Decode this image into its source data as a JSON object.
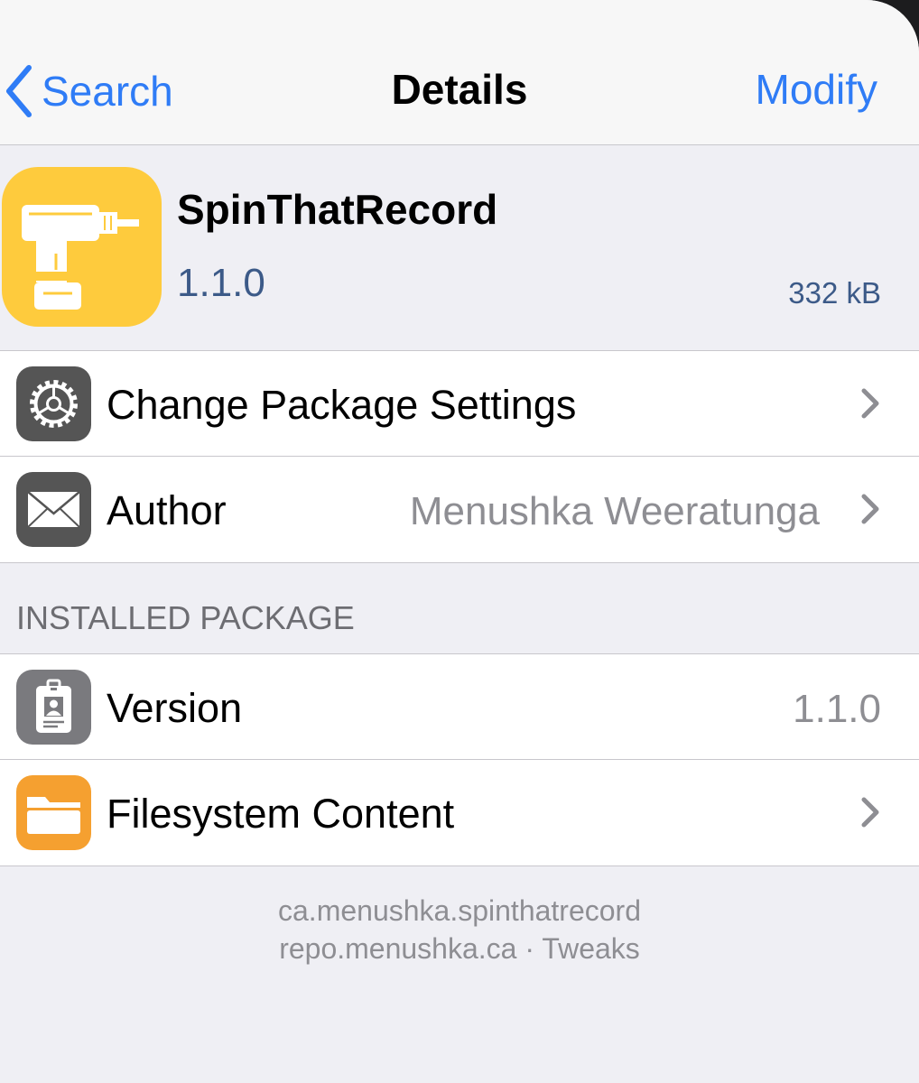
{
  "nav": {
    "back_label": "Search",
    "title": "Details",
    "action_label": "Modify"
  },
  "package": {
    "name": "SpinThatRecord",
    "version": "1.1.0",
    "size": "332 kB",
    "icon": "drill-icon"
  },
  "rows": [
    {
      "label": "Change Package Settings",
      "icon": "gear-icon"
    },
    {
      "label": "Author",
      "value": "Menushka Weeratunga",
      "icon": "mail-icon"
    }
  ],
  "installed_section": {
    "header": "INSTALLED PACKAGE",
    "rows": [
      {
        "label": "Version",
        "value": "1.1.0",
        "icon": "id-badge-icon"
      },
      {
        "label": "Filesystem Content",
        "icon": "folder-icon"
      }
    ]
  },
  "footer": {
    "identifier": "ca.menushka.spinthatrecord",
    "source": "repo.menushka.ca · Tweaks"
  },
  "colors": {
    "accent": "#2f7cf6",
    "app_icon_bg": "#fecb3d",
    "folder_icon_bg": "#f5a030",
    "gray_icon_bg": "#555555"
  }
}
